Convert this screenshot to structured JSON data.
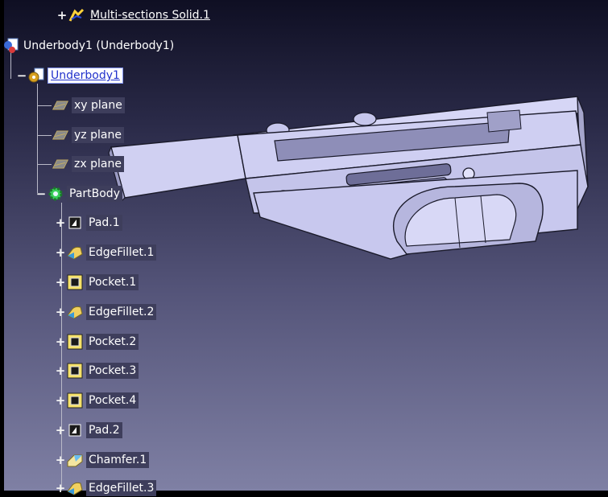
{
  "tree": {
    "top_item": {
      "label": "Multi-sections Solid.1",
      "icon": "multi-sections-solid-icon"
    },
    "product": {
      "label": "Underbody1 (Underbody1)",
      "icon": "product-icon"
    },
    "part": {
      "label": "Underbody1",
      "icon": "part-icon"
    },
    "planes": [
      {
        "label": "xy plane",
        "icon": "plane-icon"
      },
      {
        "label": "yz plane",
        "icon": "plane-icon"
      },
      {
        "label": "zx plane",
        "icon": "plane-icon"
      }
    ],
    "part_body": {
      "label": "PartBody",
      "icon": "partbody-gear-icon"
    },
    "features": [
      {
        "label": "Pad.1",
        "icon": "pad-icon"
      },
      {
        "label": "EdgeFillet.1",
        "icon": "edge-fillet-icon"
      },
      {
        "label": "Pocket.1",
        "icon": "pocket-icon"
      },
      {
        "label": "EdgeFillet.2",
        "icon": "edge-fillet-icon"
      },
      {
        "label": "Pocket.2",
        "icon": "pocket-icon"
      },
      {
        "label": "Pocket.3",
        "icon": "pocket-icon"
      },
      {
        "label": "Pocket.4",
        "icon": "pocket-icon"
      },
      {
        "label": "Pad.2",
        "icon": "pad-icon"
      },
      {
        "label": "Chamfer.1",
        "icon": "chamfer-icon"
      },
      {
        "label": "EdgeFillet.3",
        "icon": "edge-fillet-icon"
      }
    ]
  },
  "colors": {
    "background_top": "#0f0f23",
    "background_bottom": "#7f80a4",
    "model_face": "#c9c9ef",
    "model_edge": "#1a1a2a",
    "selection": "#ffffff"
  }
}
